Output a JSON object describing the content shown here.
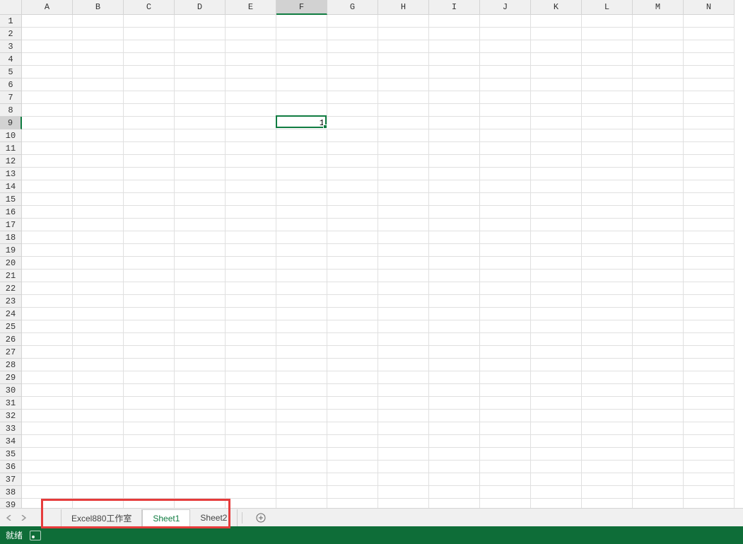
{
  "columns": [
    "A",
    "B",
    "C",
    "D",
    "E",
    "F",
    "G",
    "H",
    "I",
    "J",
    "K",
    "L",
    "M",
    "N"
  ],
  "row_count": 39,
  "selected_column": "F",
  "selected_row": 9,
  "active_cell_value": "1",
  "sheet_tabs": [
    {
      "label": "Excel880工作室",
      "active": false
    },
    {
      "label": "Sheet1",
      "active": true
    },
    {
      "label": "Sheet2",
      "active": false
    }
  ],
  "status": {
    "ready_text": "就绪"
  }
}
